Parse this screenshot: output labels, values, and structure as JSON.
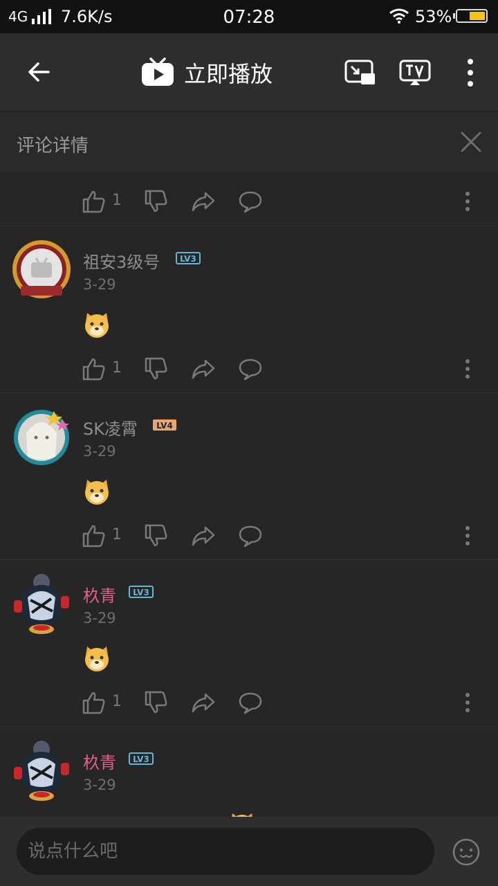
{
  "status": {
    "network": "4G",
    "speed": "7.6K/s",
    "time": "07:28",
    "battery": "53%",
    "battery_level": 0.53
  },
  "header": {
    "title": "立即播放"
  },
  "panel": {
    "title": "评论详情"
  },
  "top_actions": {
    "like_count": "1"
  },
  "comments": [
    {
      "user": "祖安3级号",
      "level": "LV3",
      "date": "3-29",
      "likes": "1",
      "name_color": "#8d8d8d",
      "level_color": "#63b6d6"
    },
    {
      "user": "SK凌霄",
      "level": "LV4",
      "date": "3-29",
      "likes": "1",
      "name_color": "#8d8d8d",
      "level_color": "#e8a66e"
    },
    {
      "user": "杦青",
      "level": "LV3",
      "date": "3-29",
      "likes": "1",
      "name_color": "#e35f8c",
      "level_color": "#63b6d6"
    },
    {
      "user": "杦青",
      "level": "LV3",
      "date": "3-29"
    }
  ],
  "input": {
    "placeholder": "说点什么吧"
  },
  "icons": [
    "back-arrow-icon",
    "play-tv-icon",
    "pip-icon",
    "tv-cast-icon",
    "more-vertical-icon",
    "close-icon",
    "thumb-up-icon",
    "thumb-down-icon",
    "share-icon",
    "reply-icon",
    "emoji-icon",
    "level-badge-icon"
  ]
}
